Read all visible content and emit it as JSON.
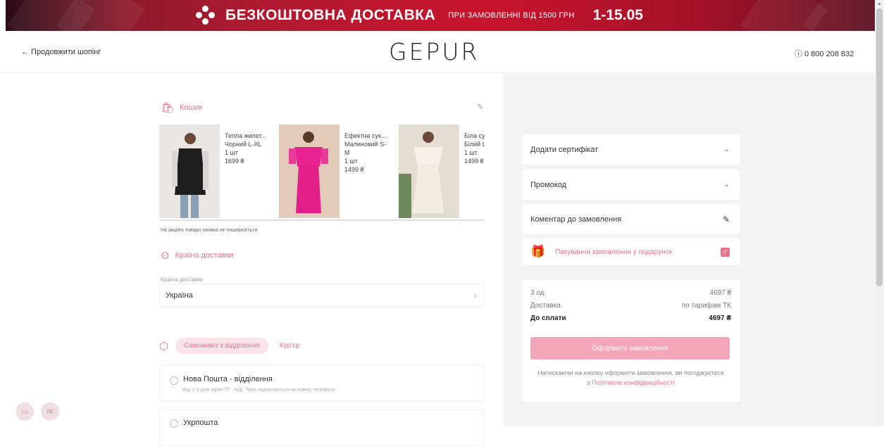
{
  "banner": {
    "main": "БЕЗКОШТОВНА ДОСТАВКА",
    "sub": "ПРИ ЗАМОВЛЕННІ ВІД 1500 ГРН",
    "date": "1-15.05"
  },
  "header": {
    "back_label": "← Продовжити шопінг",
    "logo": "GEPUR",
    "phone": "ⓘ 0 800 208 832"
  },
  "cart": {
    "title": "Кошик",
    "note": "На акційні товари знижка не поширюється",
    "products": [
      {
        "name": "Тепла жилет...",
        "variant": "Чорний L-XL",
        "qty": "1 шт",
        "price": "1699 ₴"
      },
      {
        "name": "Ефектна сук...",
        "variant": "Малиновий S-M",
        "qty": "1 шт",
        "price": "1499 ₴"
      },
      {
        "name": "Біла сук...",
        "variant": "Білий L...",
        "qty": "1 шт",
        "price": "1499 ₴"
      }
    ]
  },
  "delivery": {
    "title": "Країна доставки",
    "field_label": "Країна доставки",
    "country": "Україна",
    "tab_pickup": "Самовивіз з відділення",
    "tab_courier": "Кур'єр",
    "options": [
      {
        "name": "Нова Пошта - відділення",
        "desc": "Від 1-3 днів (крім ПТ - НД). Трек надсилається на номер телефону"
      },
      {
        "name": "Укрпошта",
        "desc": ""
      }
    ]
  },
  "sidebar": {
    "certificate": "Додати сертифікат",
    "promo": "Промокод",
    "comment": "Коментар до замовлення",
    "gift": "Пакування замовлення у подарунок",
    "summary": {
      "items_label": "3 од.",
      "items_value": "4697 ₴",
      "delivery_label": "Доставка",
      "delivery_value": "по тарифам ТК",
      "total_label": "До сплати",
      "total_value": "4697 ₴"
    },
    "order_button": "Оформити замовлення",
    "policy_prefix": "Натискаючи на кнопку оформити замовлення, ви погоджуєтеся з",
    "policy_link": "Політикою конфіденційності"
  },
  "colors": {
    "accent": "#e5748f",
    "button": "#f4a7bb",
    "banner": "#b01a30"
  }
}
